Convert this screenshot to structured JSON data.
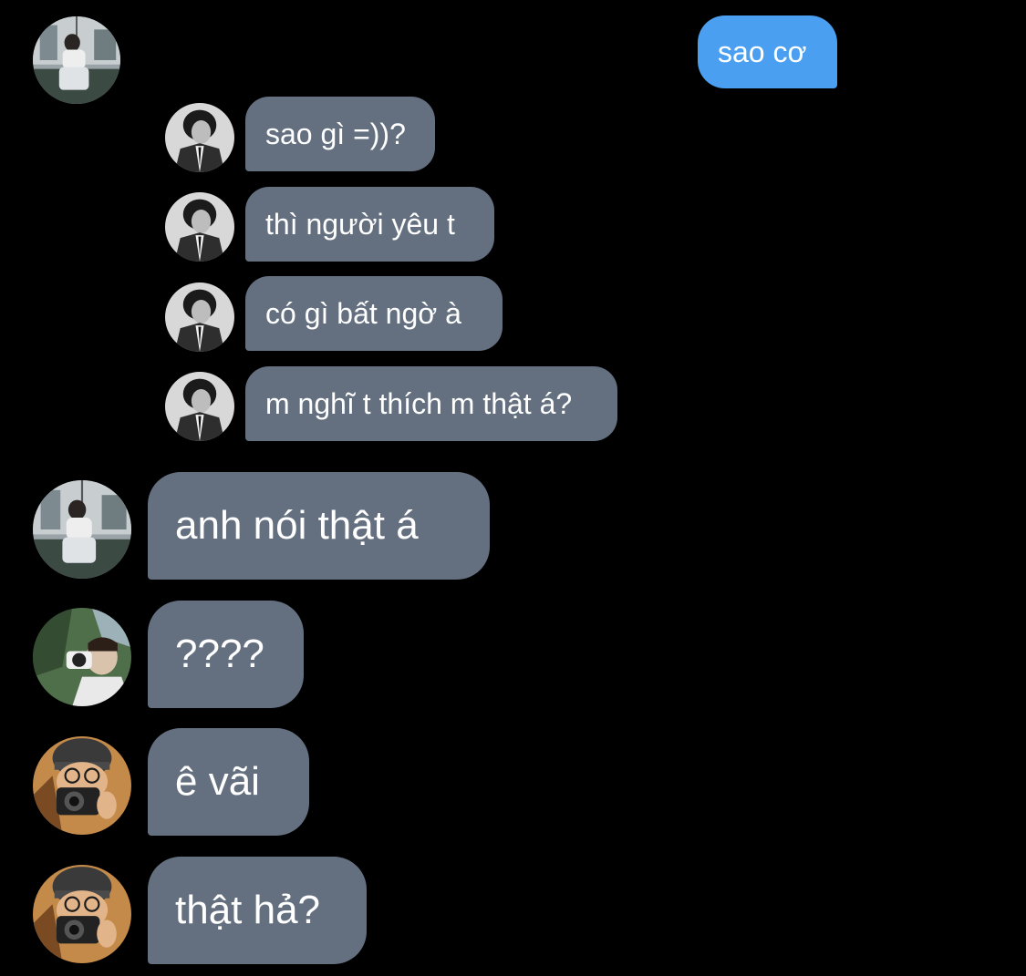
{
  "conversation": {
    "colors": {
      "background": "#000000",
      "sent_bubble": "#4a9ff0",
      "received_bubble": "#647080",
      "text": "#ffffff"
    },
    "messages": [
      {
        "sender": "me",
        "text": "sao cơ"
      },
      {
        "sender": "friend-bw",
        "text": "sao gì =))?"
      },
      {
        "sender": "friend-bw",
        "text": "thì người yêu t"
      },
      {
        "sender": "friend-bw",
        "text": "có gì bất ngờ à"
      },
      {
        "sender": "friend-bw",
        "text": "m nghĩ t thích m thật á?"
      },
      {
        "sender": "friend-window",
        "text": "anh nói thật á"
      },
      {
        "sender": "friend-camera-green",
        "text": "????"
      },
      {
        "sender": "friend-camera-hat",
        "text": "ê vãi"
      },
      {
        "sender": "friend-camera-hat",
        "text": "thật hả?"
      }
    ],
    "avatars": {
      "friend-window": {
        "icon": "window-photo-avatar"
      },
      "friend-bw": {
        "icon": "bw-portrait-avatar"
      },
      "friend-camera-green": {
        "icon": "camera-outdoor-avatar"
      },
      "friend-camera-hat": {
        "icon": "camera-hat-avatar"
      }
    }
  }
}
